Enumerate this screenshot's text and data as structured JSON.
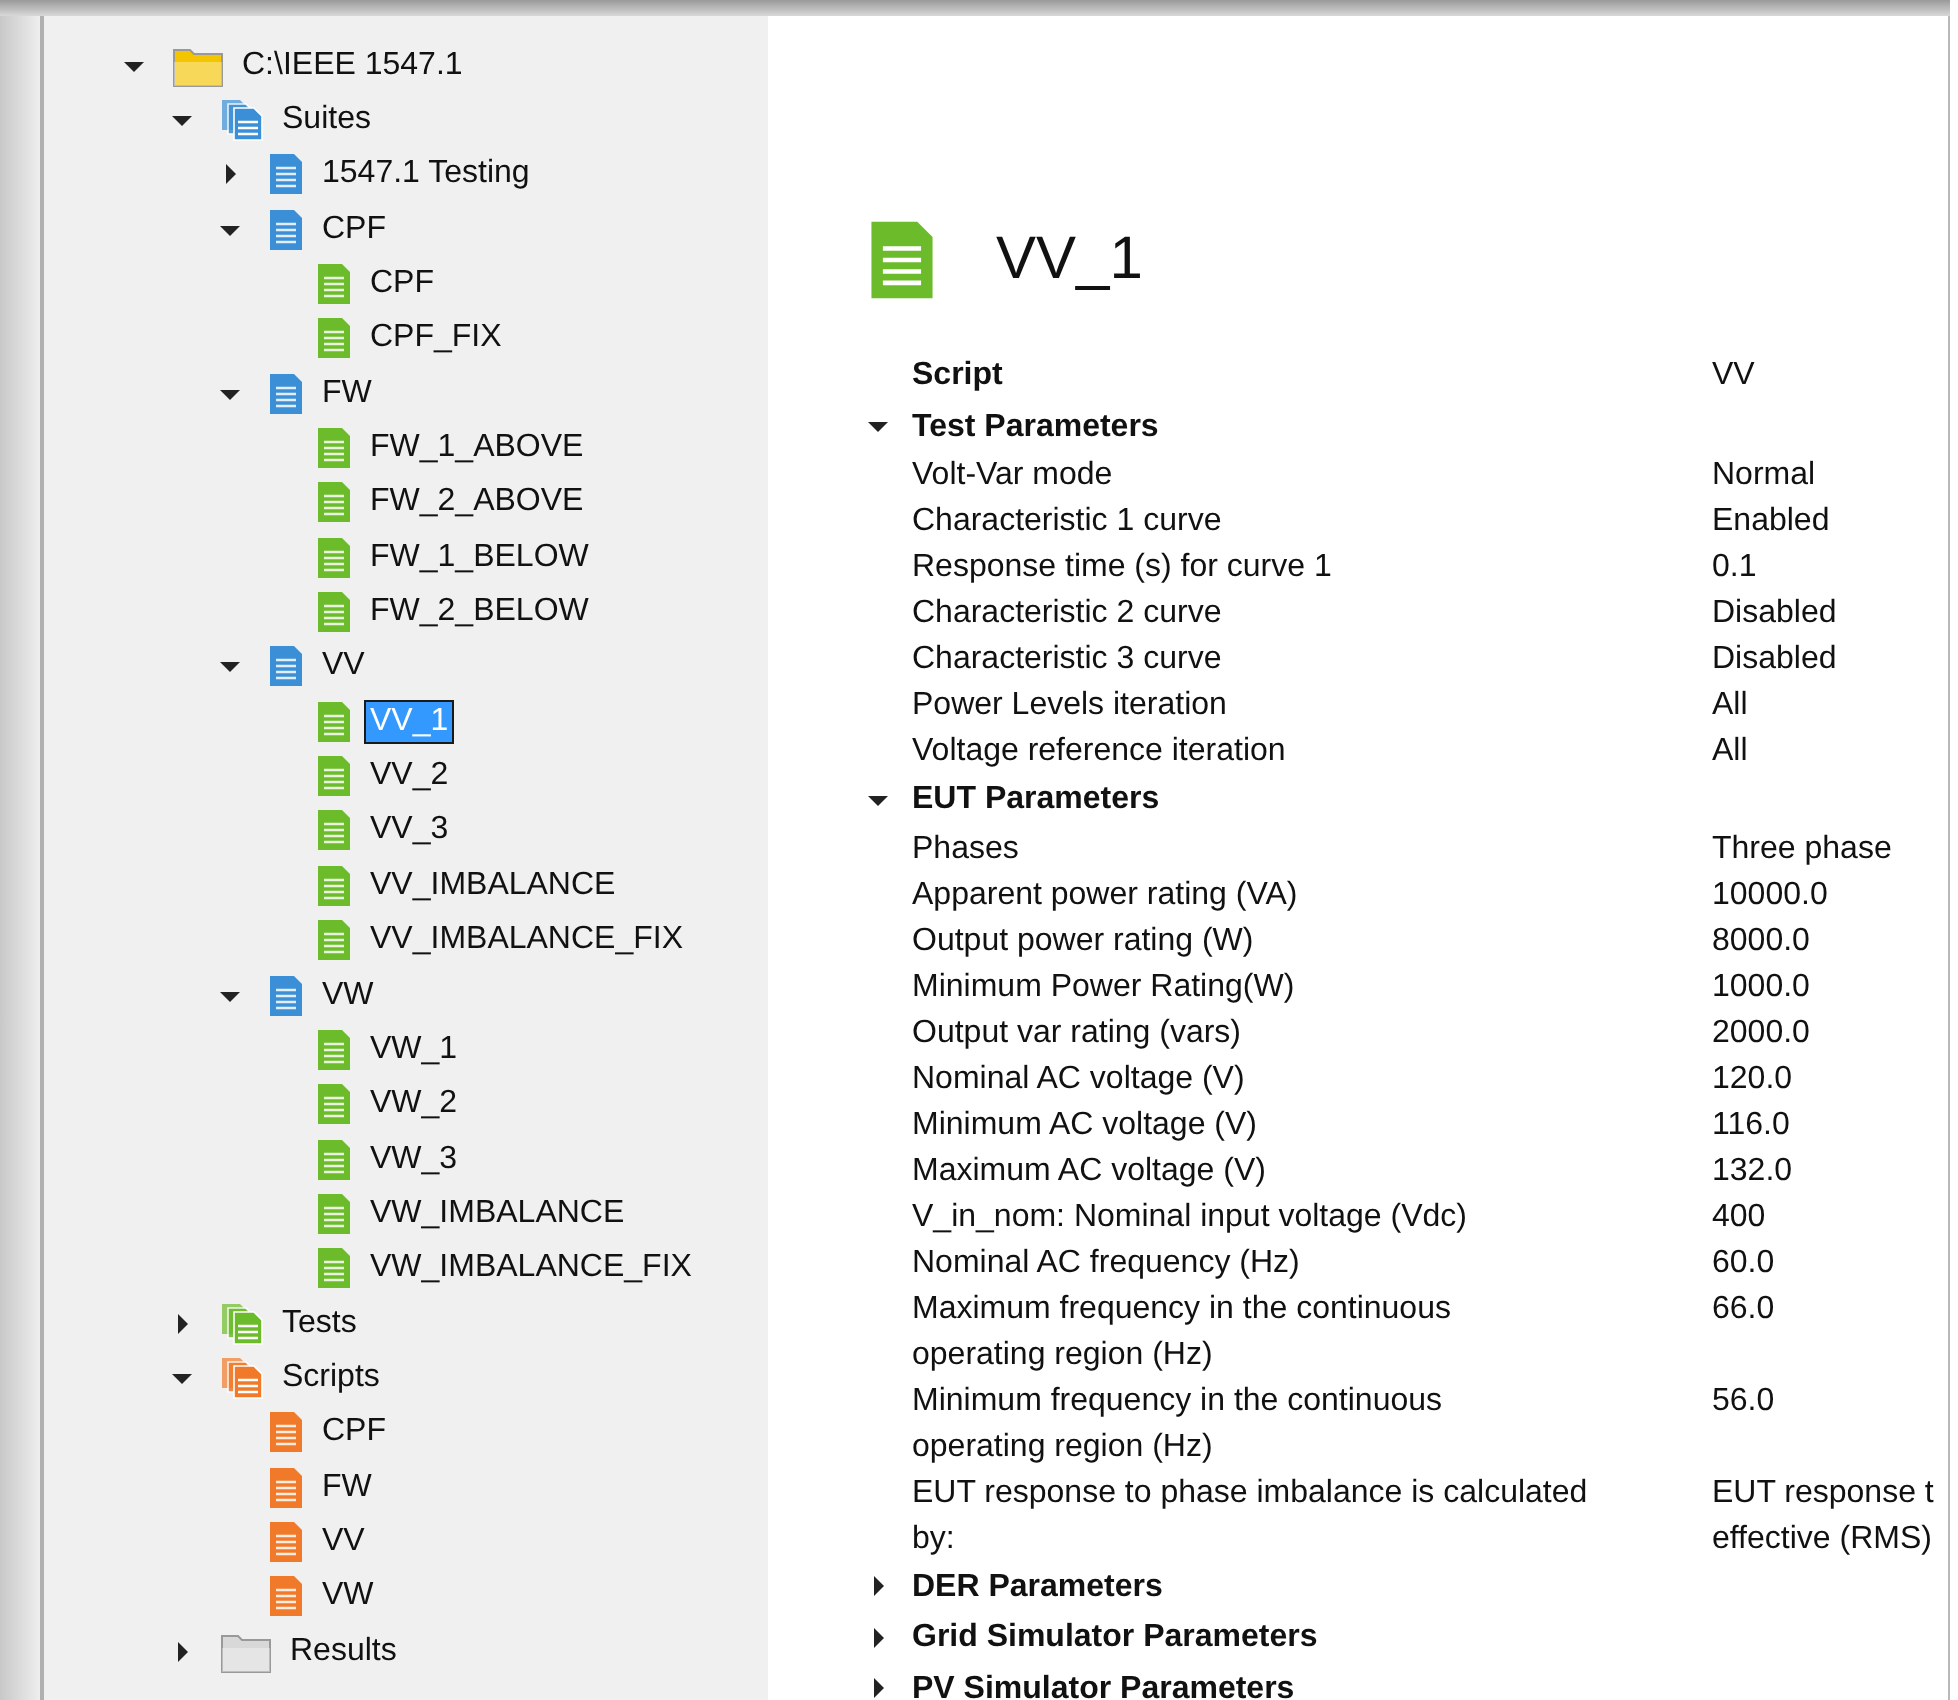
{
  "tree": [
    {
      "label": "C:\\IEEE 1547.1",
      "kind": "folder",
      "expanded": true,
      "selected": false,
      "children": [
        {
          "label": "Suites",
          "kind": "suite-group",
          "expanded": true,
          "selected": false,
          "children": [
            {
              "label": "1547.1 Testing",
              "kind": "suite",
              "expanded": false,
              "selected": false
            },
            {
              "label": "CPF",
              "kind": "suite",
              "expanded": true,
              "selected": false,
              "children": [
                {
                  "label": "CPF",
                  "kind": "test",
                  "selected": false
                },
                {
                  "label": "CPF_FIX",
                  "kind": "test",
                  "selected": false
                }
              ]
            },
            {
              "label": "FW",
              "kind": "suite",
              "expanded": true,
              "selected": false,
              "children": [
                {
                  "label": "FW_1_ABOVE",
                  "kind": "test",
                  "selected": false
                },
                {
                  "label": "FW_2_ABOVE",
                  "kind": "test",
                  "selected": false
                },
                {
                  "label": "FW_1_BELOW",
                  "kind": "test",
                  "selected": false
                },
                {
                  "label": "FW_2_BELOW",
                  "kind": "test",
                  "selected": false
                }
              ]
            },
            {
              "label": "VV",
              "kind": "suite",
              "expanded": true,
              "selected": false,
              "children": [
                {
                  "label": "VV_1",
                  "kind": "test",
                  "selected": true
                },
                {
                  "label": "VV_2",
                  "kind": "test",
                  "selected": false
                },
                {
                  "label": "VV_3",
                  "kind": "test",
                  "selected": false
                },
                {
                  "label": "VV_IMBALANCE",
                  "kind": "test",
                  "selected": false
                },
                {
                  "label": "VV_IMBALANCE_FIX",
                  "kind": "test",
                  "selected": false
                }
              ]
            },
            {
              "label": "VW",
              "kind": "suite",
              "expanded": true,
              "selected": false,
              "children": [
                {
                  "label": "VW_1",
                  "kind": "test",
                  "selected": false
                },
                {
                  "label": "VW_2",
                  "kind": "test",
                  "selected": false
                },
                {
                  "label": "VW_3",
                  "kind": "test",
                  "selected": false
                },
                {
                  "label": "VW_IMBALANCE",
                  "kind": "test",
                  "selected": false
                },
                {
                  "label": "VW_IMBALANCE_FIX",
                  "kind": "test",
                  "selected": false
                }
              ]
            }
          ]
        },
        {
          "label": "Tests",
          "kind": "test-group",
          "expanded": false,
          "selected": false
        },
        {
          "label": "Scripts",
          "kind": "script-group",
          "expanded": true,
          "selected": false,
          "children": [
            {
              "label": "CPF",
              "kind": "script",
              "selected": false
            },
            {
              "label": "FW",
              "kind": "script",
              "selected": false
            },
            {
              "label": "VV",
              "kind": "script",
              "selected": false
            },
            {
              "label": "VW",
              "kind": "script",
              "selected": false
            }
          ]
        },
        {
          "label": "Results",
          "kind": "results",
          "expanded": false,
          "selected": false
        }
      ]
    }
  ],
  "details": {
    "title": "VV_1",
    "properties": [
      {
        "kind": "item",
        "label": "Script",
        "value": "VV"
      },
      {
        "kind": "group",
        "label": "Test Parameters",
        "expanded": true,
        "items": [
          {
            "label": "Volt-Var mode",
            "value": "Normal"
          },
          {
            "label": "Characteristic 1 curve",
            "value": "Enabled"
          },
          {
            "label": "Response time (s) for curve 1",
            "value": "0.1"
          },
          {
            "label": "Characteristic 2 curve",
            "value": "Disabled"
          },
          {
            "label": "Characteristic 3 curve",
            "value": "Disabled"
          },
          {
            "label": "Power Levels iteration",
            "value": "All"
          },
          {
            "label": "Voltage reference iteration",
            "value": "All"
          }
        ]
      },
      {
        "kind": "group",
        "label": "EUT Parameters",
        "expanded": true,
        "items": [
          {
            "label": "Phases",
            "value": "Three phase"
          },
          {
            "label": "Apparent power rating (VA)",
            "value": "10000.0"
          },
          {
            "label": "Output power rating (W)",
            "value": "8000.0"
          },
          {
            "label": "Minimum Power Rating(W)",
            "value": "1000.0"
          },
          {
            "label": "Output var rating (vars)",
            "value": "2000.0"
          },
          {
            "label": "Nominal AC voltage (V)",
            "value": "120.0"
          },
          {
            "label": "Minimum AC voltage (V)",
            "value": "116.0"
          },
          {
            "label": "Maximum AC voltage (V)",
            "value": "132.0"
          },
          {
            "label": "V_in_nom: Nominal input voltage (Vdc)",
            "value": "400"
          },
          {
            "label": "Nominal AC frequency (Hz)",
            "value": "60.0"
          },
          {
            "label": "Maximum frequency in the continuous\noperating region (Hz)",
            "value": "66.0"
          },
          {
            "label": "Minimum frequency in the continuous\noperating region (Hz)",
            "value": "56.0"
          },
          {
            "label": "EUT response to phase imbalance is calculated\nby:",
            "value": "EUT response t\neffective (RMS)"
          }
        ]
      },
      {
        "kind": "group",
        "label": "DER Parameters",
        "expanded": false
      },
      {
        "kind": "group",
        "label": "Grid Simulator Parameters",
        "expanded": false
      },
      {
        "kind": "group",
        "label": "PV Simulator Parameters",
        "expanded": false
      }
    ]
  }
}
